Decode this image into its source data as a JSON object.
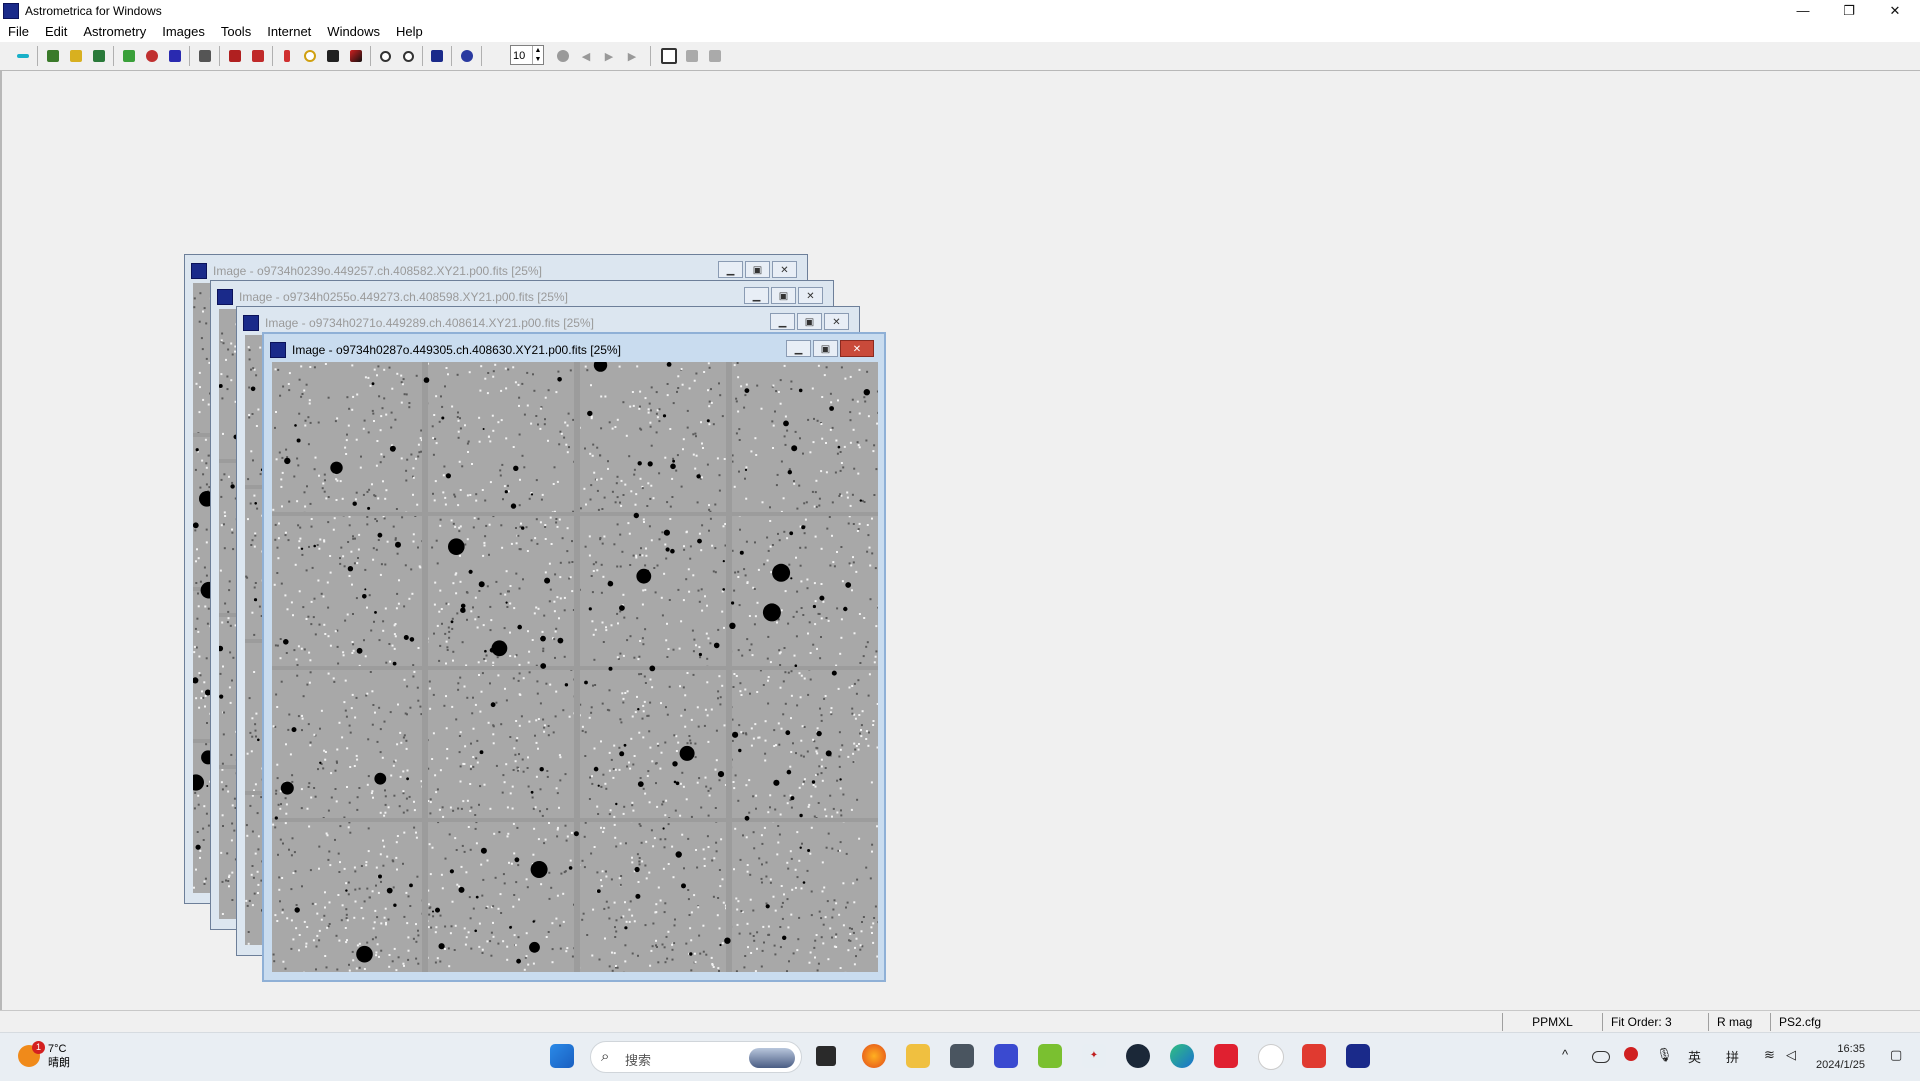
{
  "app": {
    "title": "Astrometrica for Windows"
  },
  "window_controls": {
    "minimize": "—",
    "maximize": "❐",
    "close": "✕"
  },
  "menu": [
    "File",
    "Edit",
    "Astrometry",
    "Images",
    "Tools",
    "Internet",
    "Windows",
    "Help"
  ],
  "toolbar": {
    "icons": [
      "arrow-icon",
      "open-images-icon",
      "open-more-icon",
      "save-icon",
      "data-reduction-icon",
      "flat-icon",
      "dark-icon",
      "blink-icon",
      "catalog-icon",
      "remove-icon",
      "mark-icon",
      "circle-icon",
      "track-icon",
      "color-icon",
      "zoom-in-icon",
      "zoom-out-icon",
      "settings-icon",
      "sky-icon"
    ],
    "spinner_value": "10",
    "blink_icons": [
      "record-icon",
      "prev-icon",
      "play-icon",
      "next-icon"
    ],
    "view_icons": [
      "view-icon",
      "list-icon",
      "grid-icon"
    ]
  },
  "child_windows": [
    {
      "title": "Image - o9734h0239o.449257.ch.408582.XY21.p00.fits [25%]",
      "active": false
    },
    {
      "title": "Image - o9734h0255o.449273.ch.408598.XY21.p00.fits [25%]",
      "active": false
    },
    {
      "title": "Image - o9734h0271o.449289.ch.408614.XY21.p00.fits [25%]",
      "active": false
    },
    {
      "title": "Image - o9734h0287o.449305.ch.408630.XY21.p00.fits [25%]",
      "active": true
    }
  ],
  "statusbar": {
    "catalog": "PPMXL",
    "fit_order": "Fit Order: 3",
    "magnitude": "R mag",
    "config": "PS2.cfg"
  },
  "taskbar": {
    "weather_temp": "7°C",
    "weather_desc": "晴朗",
    "weather_badge": "1",
    "search_placeholder": "搜索",
    "time": "16:35",
    "date": "2024/1/25",
    "tray": {
      "up": "^",
      "lang1": "英",
      "lang2": "拼"
    }
  }
}
